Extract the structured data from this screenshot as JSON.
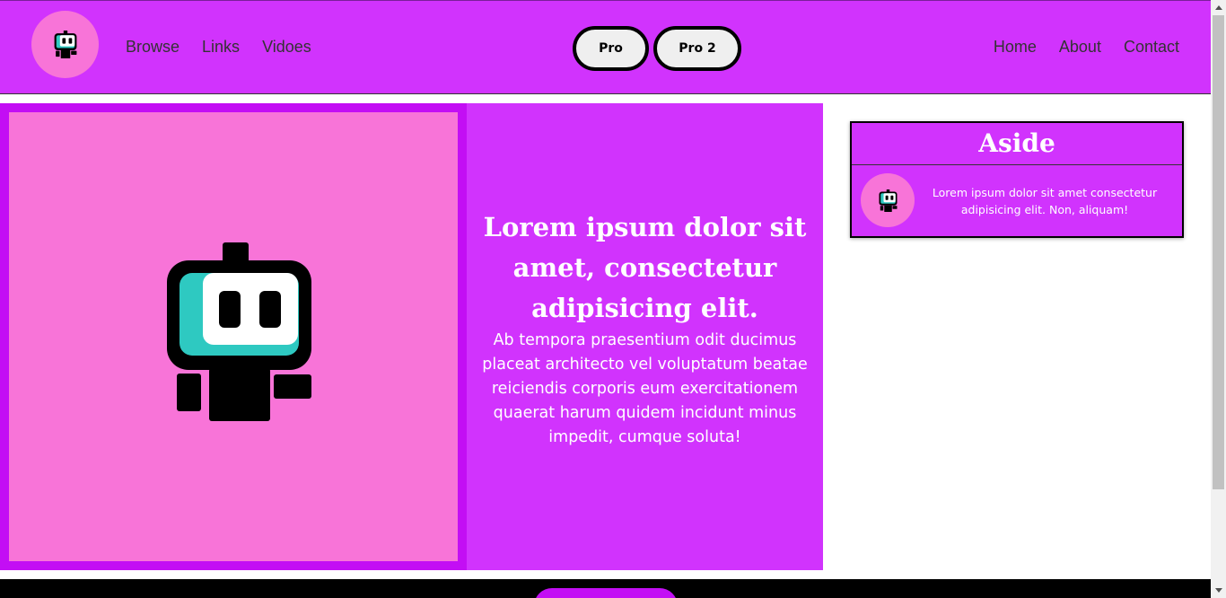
{
  "header": {
    "logo_icon": "robot-icon",
    "nav_left": [
      "Browse",
      "Links",
      "Vidoes"
    ],
    "buttons": {
      "pro_label": "Pro",
      "pro2_label": "Pro 2"
    },
    "nav_right": [
      "Home",
      "About",
      "Contact"
    ]
  },
  "main": {
    "image_icon": "robot-icon",
    "title": "Lorem ipsum dolor sit amet, consectetur adipisicing elit.",
    "body": "Ab tempora praesentium odit ducimus placeat architecto vel voluptatum beatae reiciendis corporis eum exercitationem quaerat harum quidem incidunt minus impedit, cumque soluta!"
  },
  "aside": {
    "title": "Aside",
    "avatar_icon": "robot-icon",
    "text": "Lorem ipsum dolor sit amet consectetur adipisicing elit. Non, aliquam!"
  },
  "colors": {
    "purple": "#d133fd",
    "deep_purple": "#c30ef4",
    "pink": "#f874d8",
    "teal": "#2ec9c1"
  }
}
